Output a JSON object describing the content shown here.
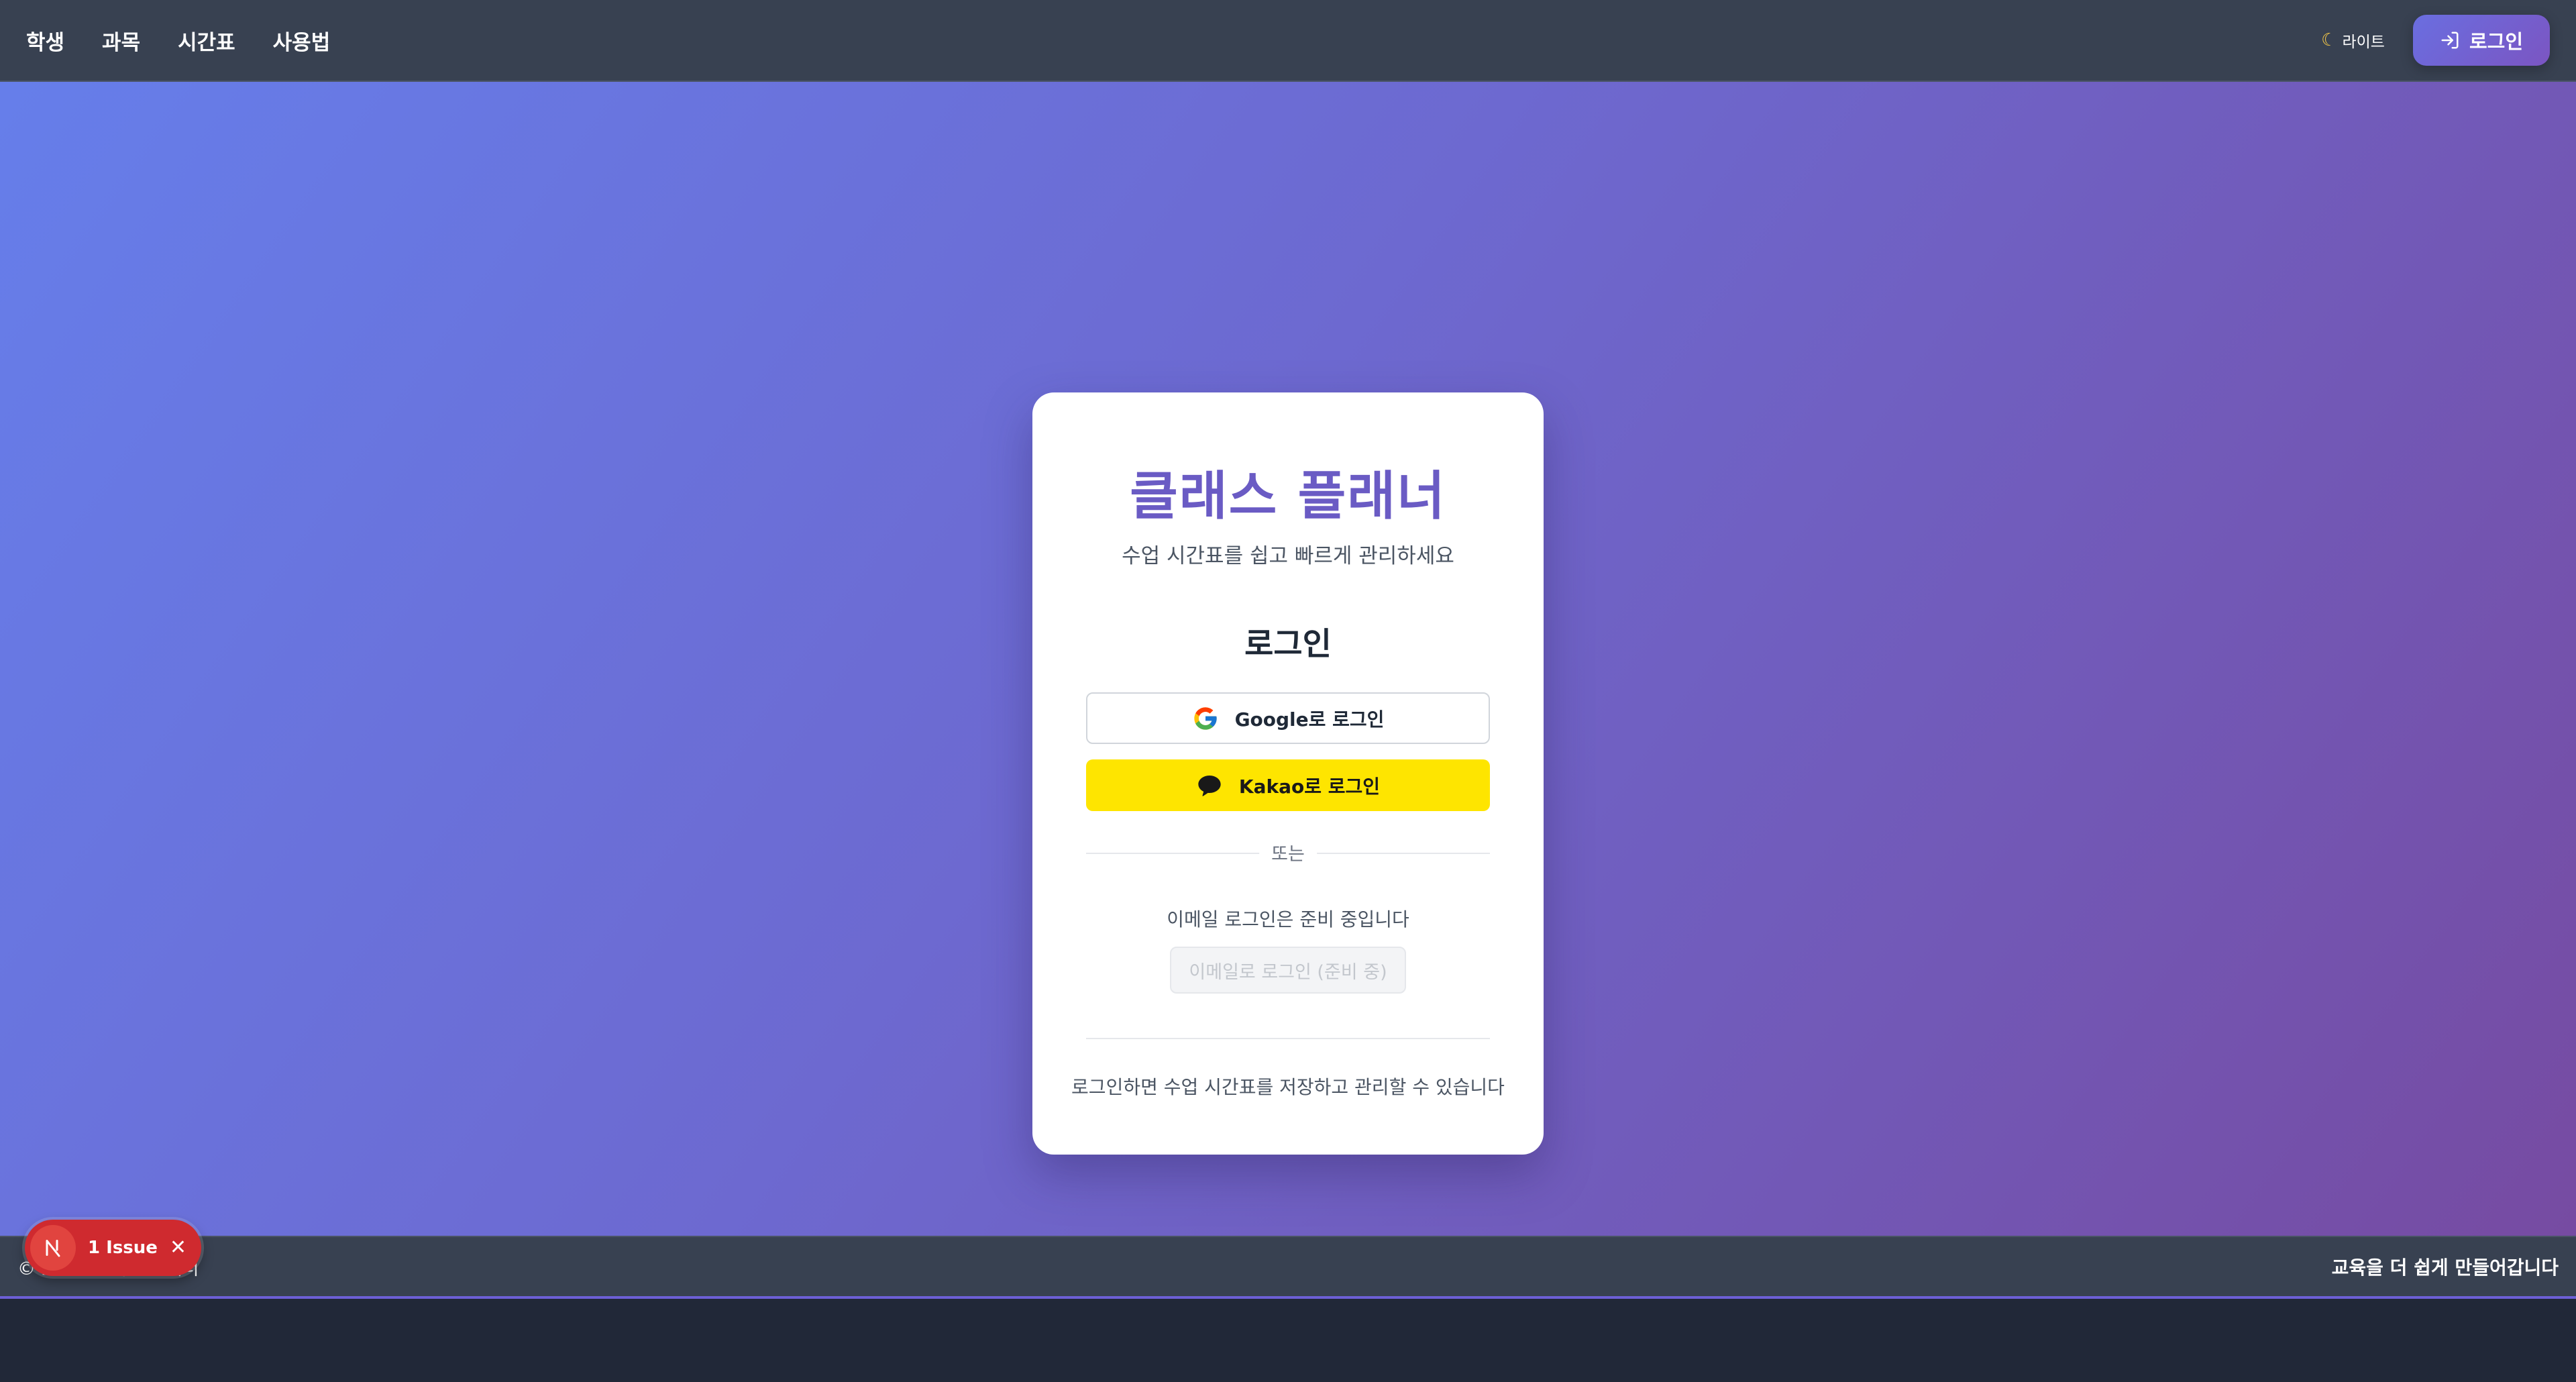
{
  "nav": {
    "links": [
      "학생",
      "과목",
      "시간표",
      "사용법"
    ],
    "theme_toggle_label": "라이트",
    "login_label": "로그인"
  },
  "card": {
    "app_title": "클래스 플래너",
    "subtitle": "수업 시간표를 쉽고 빠르게 관리하세요",
    "heading": "로그인",
    "google_label": "Google로 로그인",
    "kakao_label": "Kakao로 로그인",
    "divider_label": "또는",
    "email_notice": "이메일 로그인은 준비 중입니다",
    "email_button_label": "이메일로 로그인 (준비 중)",
    "footnote": "로그인하면 수업 시간표를 저장하고 관리할 수 있습니다"
  },
  "footer": {
    "copyright": "© 2024 클래스 플래너",
    "tagline": "교육을 더 쉽게 만들어갑니다"
  },
  "dev_overlay": {
    "issue_label": "1 Issue"
  },
  "colors": {
    "nav_bg": "#384151",
    "hero_gradient_start": "#667eea",
    "hero_gradient_end": "#764ba2",
    "title_purple": "#6a5bc4",
    "kakao_yellow": "#fee500",
    "issue_red": "#cf2a2f"
  },
  "icons": {
    "theme": "moon-icon",
    "login": "login-arrow-icon",
    "google": "google-logo-icon",
    "kakao": "chat-bubble-icon",
    "dev": "nextjs-logo-icon",
    "close": "close-icon"
  }
}
